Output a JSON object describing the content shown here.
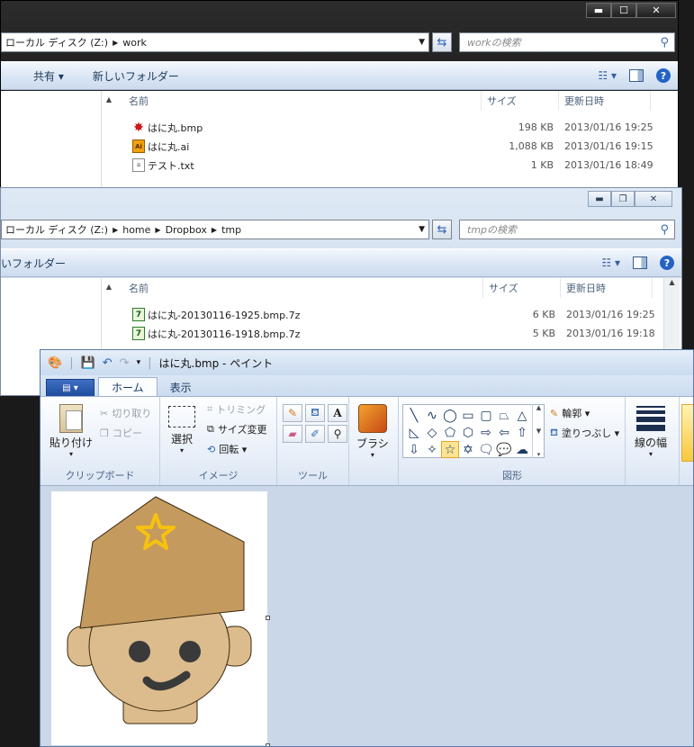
{
  "window_work": {
    "address": [
      "ローカル ディスク (Z:)",
      "work"
    ],
    "search_placeholder": "workの検索",
    "toolbar": {
      "share": "共有 ▾",
      "new_folder": "新しいフォルダー"
    },
    "columns": {
      "name": "名前",
      "size": "サイズ",
      "date": "更新日時"
    },
    "files": [
      {
        "name": "はに丸.bmp",
        "size": "198 KB",
        "date": "2013/01/16 19:25",
        "icon": "paint-bitmap-icon"
      },
      {
        "name": "はに丸.ai",
        "size": "1,088 KB",
        "date": "2013/01/16 19:15",
        "icon": "illustrator-icon"
      },
      {
        "name": "テスト.txt",
        "size": "1 KB",
        "date": "2013/01/16 18:49",
        "icon": "text-file-icon"
      }
    ],
    "controls": {
      "minimize": "▬",
      "maximize": "☐",
      "close": "✕"
    }
  },
  "window_tmp": {
    "address": [
      "ローカル ディスク (Z:)",
      "home",
      "Dropbox",
      "tmp"
    ],
    "search_placeholder": "tmpの検索",
    "toolbar": {
      "new_folder": "いフォルダー"
    },
    "columns": {
      "name": "名前",
      "size": "サイズ",
      "date": "更新日時"
    },
    "files": [
      {
        "name": "はに丸-20130116-1925.bmp.7z",
        "size": "6 KB",
        "date": "2013/01/16 19:25",
        "icon": "7z-archive-icon"
      },
      {
        "name": "はに丸-20130116-1918.bmp.7z",
        "size": "5 KB",
        "date": "2013/01/16 19:18",
        "icon": "7z-archive-icon"
      }
    ],
    "controls": {
      "minimize": "▬",
      "restore": "❐",
      "close": "✕"
    }
  },
  "paint": {
    "title": "はに丸.bmp - ペイント",
    "tabs": {
      "file": "▤ ▾",
      "home": "ホーム",
      "view": "表示"
    },
    "clipboard": {
      "paste": "貼り付け",
      "cut": "切り取り",
      "copy": "コピー",
      "label": "クリップボード"
    },
    "image": {
      "select": "選択",
      "crop": "トリミング",
      "resize": "サイズ変更",
      "rotate": "回転 ▾",
      "label": "イメージ"
    },
    "tools": {
      "label": "ツール"
    },
    "brush": {
      "label": "ブラシ"
    },
    "shapes": {
      "outline": "輪郭 ▾",
      "fill": "塗りつぶし ▾",
      "label": "図形"
    },
    "line_width": {
      "label": "線の幅"
    },
    "colors": {
      "hat": "#c49a5e",
      "face": "#dcbc8c",
      "star": "#f6c20f",
      "eyes": "#3a3a3a"
    }
  }
}
